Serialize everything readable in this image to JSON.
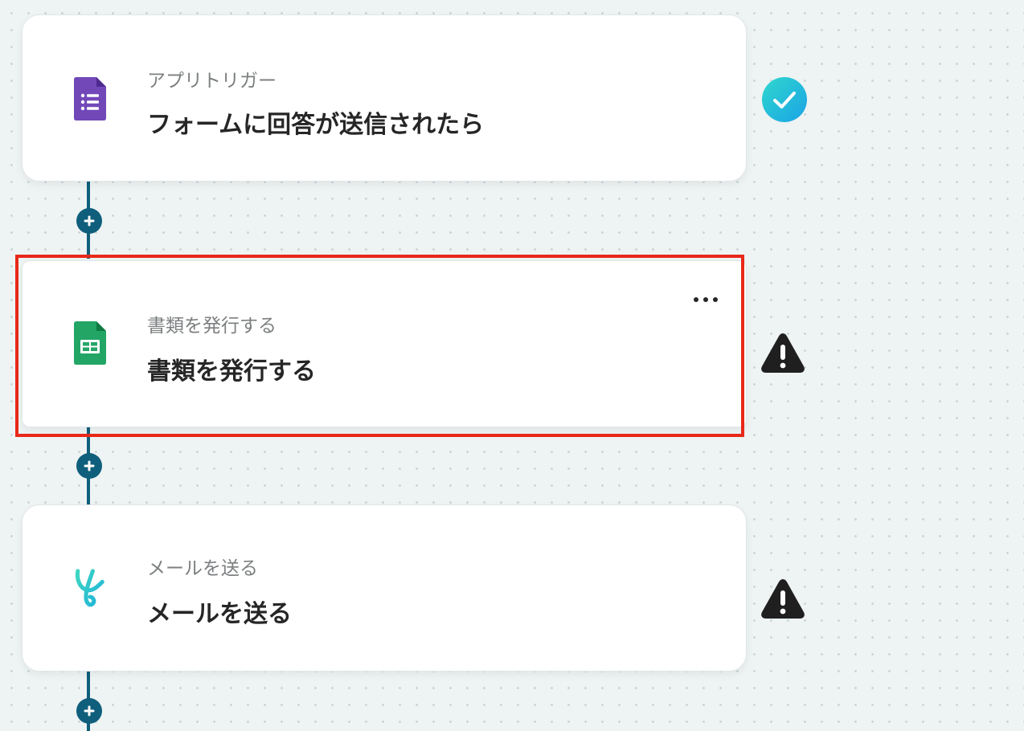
{
  "steps": [
    {
      "subtitle": "アプリトリガー",
      "title": "フォームに回答が送信されたら",
      "icon": "google-forms-icon",
      "status": "complete",
      "status_icon": "check-circle-icon"
    },
    {
      "subtitle": "書類を発行する",
      "title": "書類を発行する",
      "icon": "google-sheets-icon",
      "status": "warning",
      "status_icon": "warning-icon",
      "selected": true
    },
    {
      "subtitle": "メールを送る",
      "title": "メールを送る",
      "icon": "yoom-mail-icon",
      "status": "warning",
      "status_icon": "warning-icon"
    }
  ],
  "colors": {
    "connector": "#0f5f7c",
    "highlight": "#e8281a",
    "check_gradient_start": "#2fd8cd",
    "check_gradient_end": "#1aa3e6",
    "forms_purple": "#7248b9",
    "sheets_green": "#23a566",
    "mail_teal": "#2ac9c4"
  }
}
